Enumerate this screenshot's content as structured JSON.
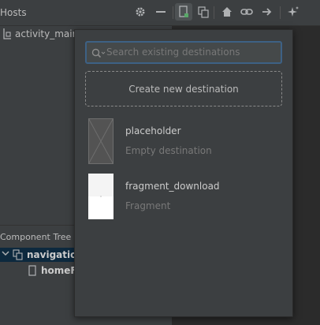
{
  "hosts": {
    "title": "Hosts",
    "item_label": "activity_main"
  },
  "toolbar": {
    "buttons": [
      "gear-icon",
      "minus-icon",
      "new-destination-icon",
      "nested-graph-icon",
      "home-icon",
      "link-icon",
      "arrow-right-icon",
      "sparkle-icon"
    ]
  },
  "component_tree": {
    "title": "Component Tree",
    "root_label": "navigation",
    "child_label": "homeF"
  },
  "popup": {
    "search_placeholder": "Search existing destinations",
    "create_label": "Create new destination",
    "destinations": [
      {
        "name": "placeholder",
        "subtitle": "Empty destination"
      },
      {
        "name": "fragment_download",
        "subtitle": "Fragment"
      }
    ]
  },
  "colors": {
    "panel": "#3c3f41",
    "accent_border": "#3d6185",
    "selection": "#0d293e"
  }
}
